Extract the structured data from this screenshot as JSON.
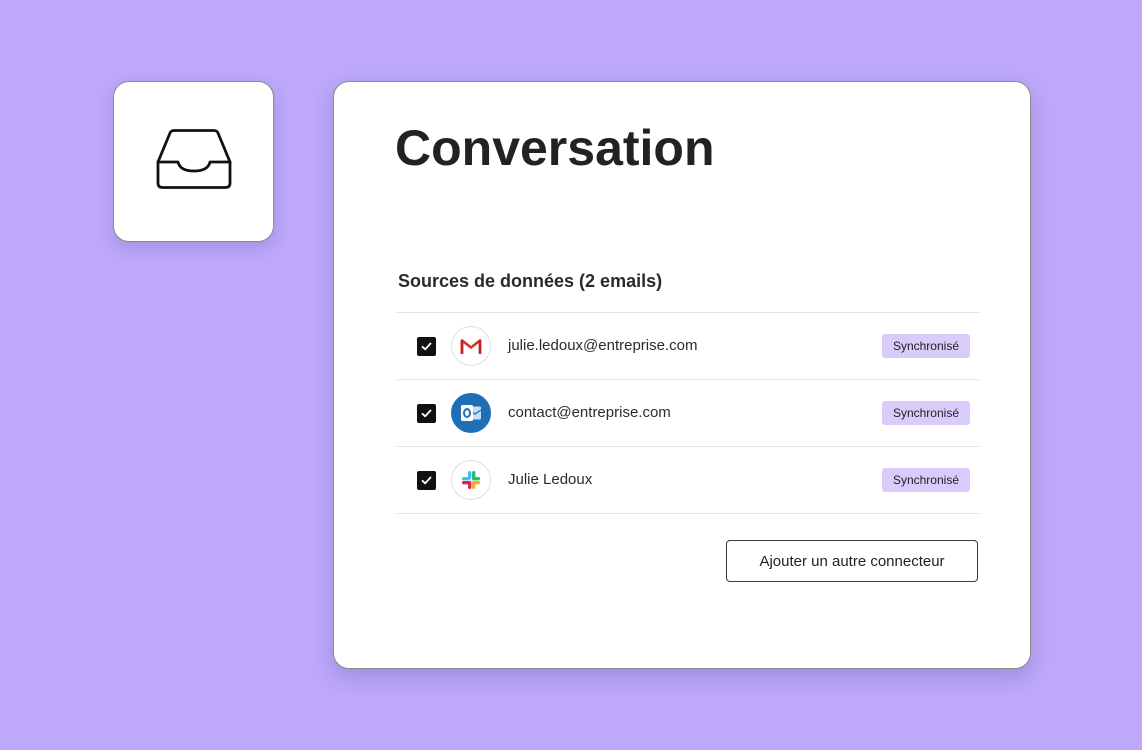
{
  "tile": {
    "icon": "inbox-tray-icon"
  },
  "card": {
    "title": "Conversation",
    "section_title": "Sources de données (2 emails)",
    "sources": [
      {
        "label": "julie.ledoux@entreprise.com",
        "icon": "gmail-icon",
        "checked": true,
        "status": "Synchronisé"
      },
      {
        "label": "contact@entreprise.com",
        "icon": "outlook-icon",
        "checked": true,
        "status": "Synchronisé"
      },
      {
        "label": "Julie Ledoux",
        "icon": "slack-icon",
        "checked": true,
        "status": "Synchronisé"
      }
    ],
    "add_button_label": "Ajouter un autre connecteur"
  },
  "colors": {
    "background": "#bda8fa",
    "badge": "#d9ccfb",
    "outlook_blue": "#1f6fb6",
    "gmail_red": "#d93025"
  }
}
